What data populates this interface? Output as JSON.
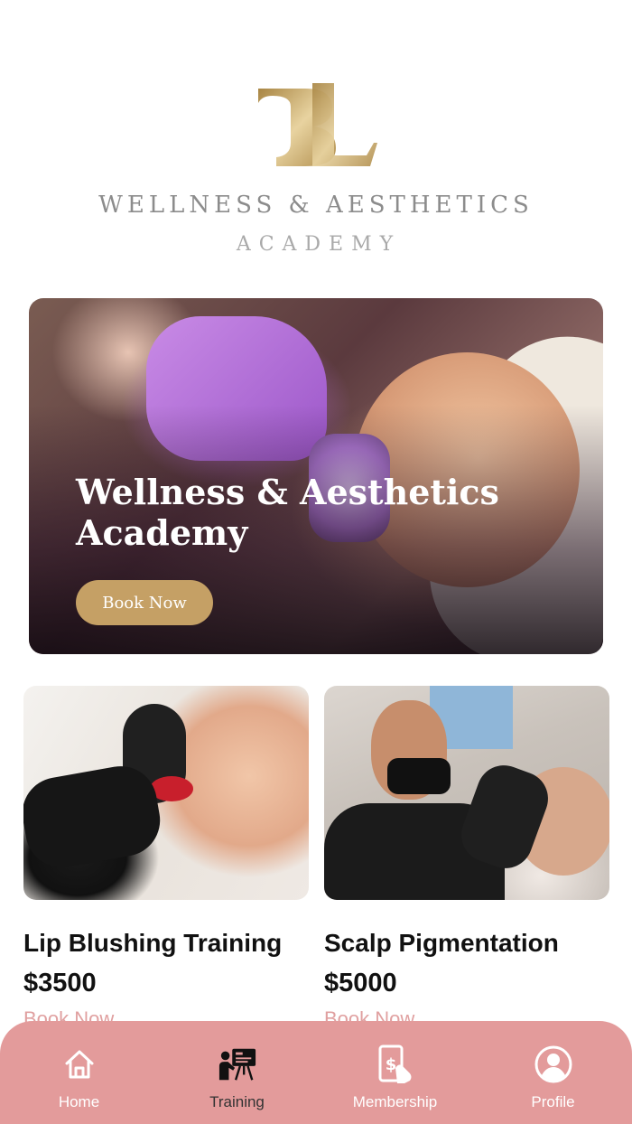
{
  "brand": {
    "monogram": "BL",
    "line1": "WELLNESS & AESTHETICS",
    "line2": "ACADEMY",
    "gold": "#c9a767"
  },
  "hero": {
    "title": "Wellness & Aesthetics Academy",
    "button_label": "Book Now",
    "button_color": "#c5a065"
  },
  "courses": [
    {
      "title": "Lip Blushing Training",
      "price": "$3500",
      "cta": "Book Now"
    },
    {
      "title": "Scalp Pigmentation",
      "price": "$5000",
      "cta": "Book Now"
    }
  ],
  "nav": {
    "background": "#e39b9b",
    "items": [
      {
        "label": "Home",
        "icon": "home-icon",
        "active": false
      },
      {
        "label": "Training",
        "icon": "training-icon",
        "active": true
      },
      {
        "label": "Membership",
        "icon": "membership-icon",
        "active": false
      },
      {
        "label": "Profile",
        "icon": "profile-icon",
        "active": false
      }
    ]
  }
}
